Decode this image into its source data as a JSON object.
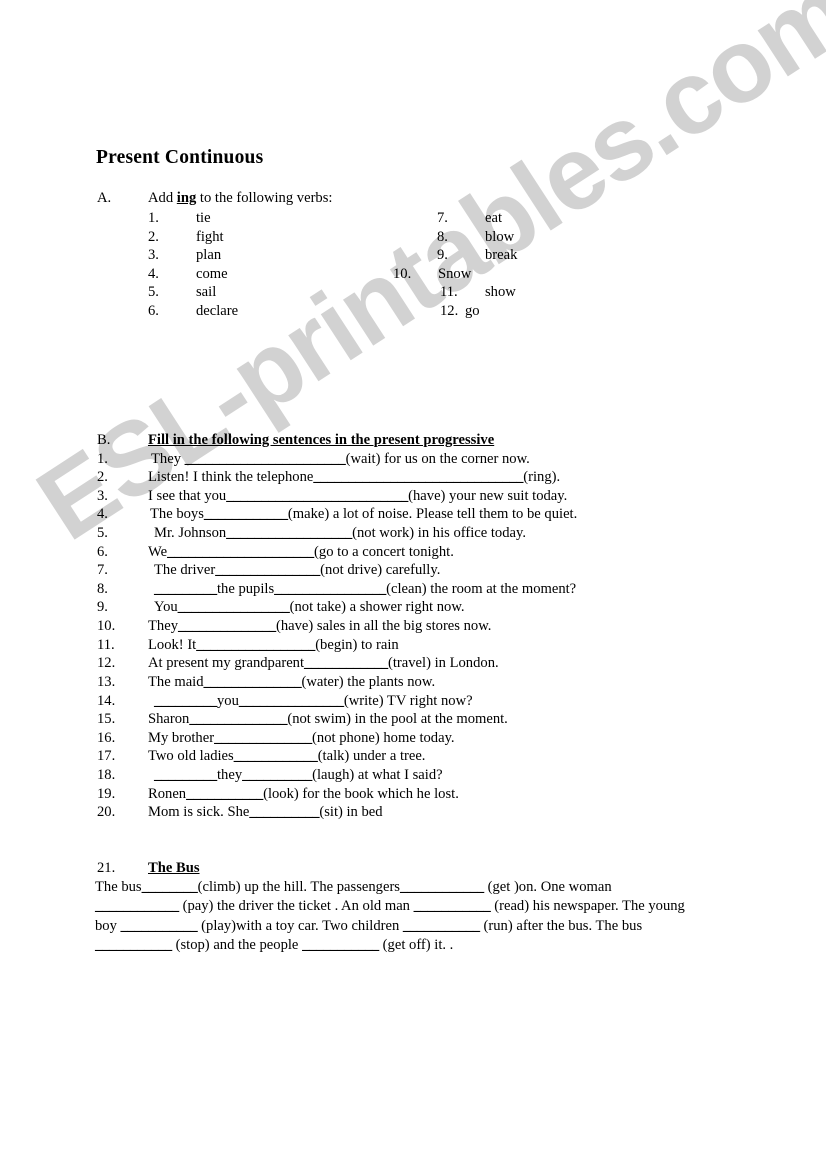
{
  "document": {
    "title": "Present Continuous"
  },
  "section_a": {
    "label": "A.",
    "instruction_before": "Add ",
    "instruction_bold": "ing",
    "instruction_after": " to the following verbs:",
    "items_left": [
      {
        "num": "1.",
        "word": "tie"
      },
      {
        "num": "2.",
        "word": "fight"
      },
      {
        "num": "3.",
        "word": "plan"
      },
      {
        "num": "4.",
        "word": "come"
      },
      {
        "num": "5.",
        "word": "sail"
      },
      {
        "num": "6.",
        "word": "declare"
      }
    ],
    "items_right": [
      {
        "num": "7.",
        "word": "eat"
      },
      {
        "num": "8.",
        "word": "blow"
      },
      {
        "num": "9.",
        "word": "break"
      },
      {
        "num": "10.",
        "word": "Snow"
      },
      {
        "num": "11.",
        "word": "show"
      },
      {
        "num": "12.",
        "word": "go"
      }
    ]
  },
  "section_b": {
    "label": "B.",
    "heading": "Fill in the following sentences in the present progressive",
    "questions": [
      {
        "num": "1.",
        "pre": "They ",
        "blank": "_______________________",
        "post": "(wait) for us on the corner now."
      },
      {
        "num": "2.",
        "pre": "Listen! I think the telephone",
        "blank": "______________________________",
        "post": "(ring)."
      },
      {
        "num": "3.",
        "pre": "I see that you",
        "blank": "__________________________",
        "post": "(have) your new suit today."
      },
      {
        "num": "4.",
        "pre": "The boys",
        "blank": "____________",
        "post": "(make) a lot of noise. Please tell them to be quiet."
      },
      {
        "num": "5.",
        "pre": "Mr. Johnson",
        "blank": "__________________",
        "post": "(not work) in his office today."
      },
      {
        "num": "6.",
        "pre": "We",
        "blank": "_____________________",
        "post": "(go to a concert tonight."
      },
      {
        "num": "7.",
        "pre": "The  driver",
        "blank": "_______________",
        "post": "(not drive) carefully."
      },
      {
        "num": "8.",
        "pre": "",
        "blank": "_________",
        "mid": "the pupils",
        "blank2": "________________",
        "post": "(clean) the room at the moment?"
      },
      {
        "num": "9.",
        "pre": "You",
        "blank": "________________",
        "post": "(not take) a shower right now."
      },
      {
        "num": "10.",
        "pre": "They",
        "blank": "______________",
        "post": "(have) sales in all the big stores now."
      },
      {
        "num": "11.",
        "pre": "Look! It",
        "blank": "_________________",
        "post": "(begin) to rain"
      },
      {
        "num": "12.",
        "pre": "At present my grandparent",
        "blank": "____________",
        "post": "(travel) in London."
      },
      {
        "num": "13.",
        "pre": "The maid",
        "blank": "______________",
        "post": "(water) the plants now."
      },
      {
        "num": "14.",
        "pre": "",
        "blank": "_________",
        "mid": "you",
        "blank2": "_______________",
        "post": "(write) TV right now?"
      },
      {
        "num": "15.",
        "pre": "Sharon",
        "blank": "______________",
        "post": "(not swim) in the pool at the moment."
      },
      {
        "num": "16.",
        "pre": "My brother",
        "blank": "______________",
        "post": "(not phone) home today."
      },
      {
        "num": "17.",
        "pre": "Two old ladies",
        "blank": "____________",
        "post": "(talk) under a tree."
      },
      {
        "num": "18.",
        "pre": "",
        "blank": "_________",
        "mid": "they",
        "blank2": "__________",
        "post": "(laugh) at what I said?"
      },
      {
        "num": "19.",
        "pre": "Ronen",
        "blank": "___________",
        "post": "(look) for the book which he lost."
      },
      {
        "num": "20.",
        "pre": "Mom is sick. She",
        "blank": "__________",
        "post": "(sit) in bed"
      }
    ]
  },
  "section_c": {
    "label": "21.",
    "heading": "The Bus",
    "paragraph_parts": [
      {
        "t": "The bus"
      },
      {
        "t": "________",
        "b": true
      },
      {
        "t": "(climb) up the hill. The passengers"
      },
      {
        "t": "____________",
        "b": true
      },
      {
        "t": " (get )on. One woman "
      },
      {
        "t": "____________",
        "b": true
      },
      {
        "t": " (pay) the driver the ticket . An old man "
      },
      {
        "t": "___________",
        "b": true
      },
      {
        "t": " (read) his newspaper. The young boy "
      },
      {
        "t": "___________",
        "b": true
      },
      {
        "t": " (play)with a toy car. Two children "
      },
      {
        "t": "___________",
        "b": true
      },
      {
        "t": " (run) after  the bus. The bus "
      },
      {
        "t": "___________",
        "b": true
      },
      {
        "t": " (stop) and the people "
      },
      {
        "t": "___________",
        "b": true
      },
      {
        "t": " (get off) it. ."
      }
    ]
  },
  "watermark": {
    "text": "ESL-printables.com",
    "color": "#d2d2d2"
  }
}
